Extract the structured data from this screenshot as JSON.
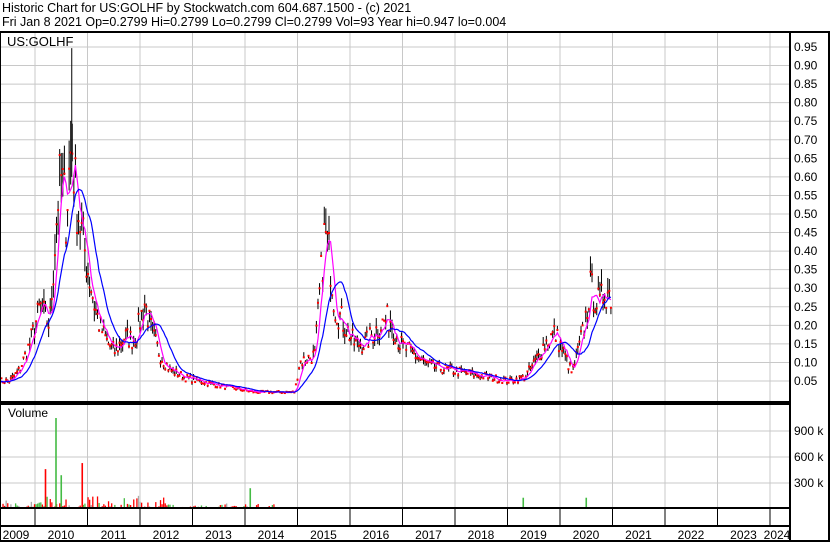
{
  "header": {
    "line1": "Historic Chart for US:GOLHF by Stockwatch.com 604.687.1500 - (c) 2021",
    "line2": "Fri Jan  8 2021  Op=0.2799  Hi=0.2799  Lo=0.2799  Cl=0.2799  Vol=93  Year hi=0.947  lo=0.004"
  },
  "chart_data": [
    {
      "type": "line",
      "title": "US:GOLHF",
      "ylim": [
        0,
        0.97
      ],
      "yticks": [
        "0.95",
        "0.90",
        "0.85",
        "0.80",
        "0.75",
        "0.70",
        "0.65",
        "0.60",
        "0.55",
        "0.50",
        "0.45",
        "0.40",
        "0.35",
        "0.30",
        "0.25",
        "0.20",
        "0.15",
        "0.10",
        "0.05"
      ],
      "x": [
        2009.33,
        2009.52,
        2009.71,
        2009.9,
        2010.1,
        2010.28,
        2010.44,
        2010.51,
        2010.59,
        2010.7,
        2010.78,
        2010.89,
        2011.01,
        2011.14,
        2011.23,
        2011.39,
        2011.52,
        2011.71,
        2011.9,
        2012.09,
        2012.23,
        2012.38,
        2012.57,
        2012.85,
        2013.14,
        2013.43,
        2013.81,
        2014.19,
        2014.57,
        2014.95,
        2015.04,
        2015.33,
        2015.43,
        2015.52,
        2015.62,
        2015.71,
        2015.9,
        2016.09,
        2016.28,
        2016.57,
        2016.76,
        2016.95,
        2017.23,
        2017.52,
        2017.9,
        2018.28,
        2018.66,
        2019.04,
        2019.33,
        2019.52,
        2019.71,
        2019.9,
        2020.09,
        2020.23,
        2020.38,
        2020.47,
        2020.57,
        2020.66,
        2020.76,
        2020.85,
        2020.99
      ],
      "close": [
        0.05,
        0.05,
        0.08,
        0.15,
        0.25,
        0.2,
        0.55,
        0.6,
        0.5,
        0.7,
        0.55,
        0.45,
        0.35,
        0.25,
        0.2,
        0.15,
        0.13,
        0.17,
        0.16,
        0.26,
        0.18,
        0.12,
        0.08,
        0.06,
        0.05,
        0.04,
        0.03,
        0.02,
        0.02,
        0.02,
        0.1,
        0.12,
        0.3,
        0.45,
        0.38,
        0.25,
        0.2,
        0.15,
        0.15,
        0.2,
        0.22,
        0.15,
        0.12,
        0.09,
        0.08,
        0.07,
        0.06,
        0.05,
        0.06,
        0.1,
        0.15,
        0.18,
        0.12,
        0.07,
        0.15,
        0.2,
        0.3,
        0.28,
        0.25,
        0.3,
        0.28
      ],
      "year_high": 0.947,
      "series": [
        {
          "name": "price",
          "color": "#000000"
        },
        {
          "name": "short MA",
          "color": "#ff00ff"
        },
        {
          "name": "long MA",
          "color": "#0000ff"
        }
      ]
    },
    {
      "type": "bar",
      "title": "Volume",
      "yticks": [
        "900 k",
        "600 k",
        "300 k"
      ],
      "ylim": [
        0,
        1200000
      ],
      "spikes": [
        {
          "x": 2010.4,
          "v": 1050000,
          "color": "#44bb44"
        },
        {
          "x": 2010.2,
          "v": 460000,
          "color": "#ff0000"
        },
        {
          "x": 2010.9,
          "v": 530000,
          "color": "#ff0000"
        },
        {
          "x": 2010.5,
          "v": 390000,
          "color": "#44bb44"
        },
        {
          "x": 2014.1,
          "v": 240000,
          "color": "#44bb44"
        },
        {
          "x": 2020.5,
          "v": 130000,
          "color": "#44bb44"
        },
        {
          "x": 2019.3,
          "v": 130000,
          "color": "#44bb44"
        }
      ]
    }
  ],
  "xaxis": {
    "years": [
      "2009",
      "2010",
      "2011",
      "2012",
      "2013",
      "2014",
      "2015",
      "2016",
      "2017",
      "2018",
      "2019",
      "2020",
      "2021",
      "2022",
      "2023",
      "2024"
    ]
  }
}
